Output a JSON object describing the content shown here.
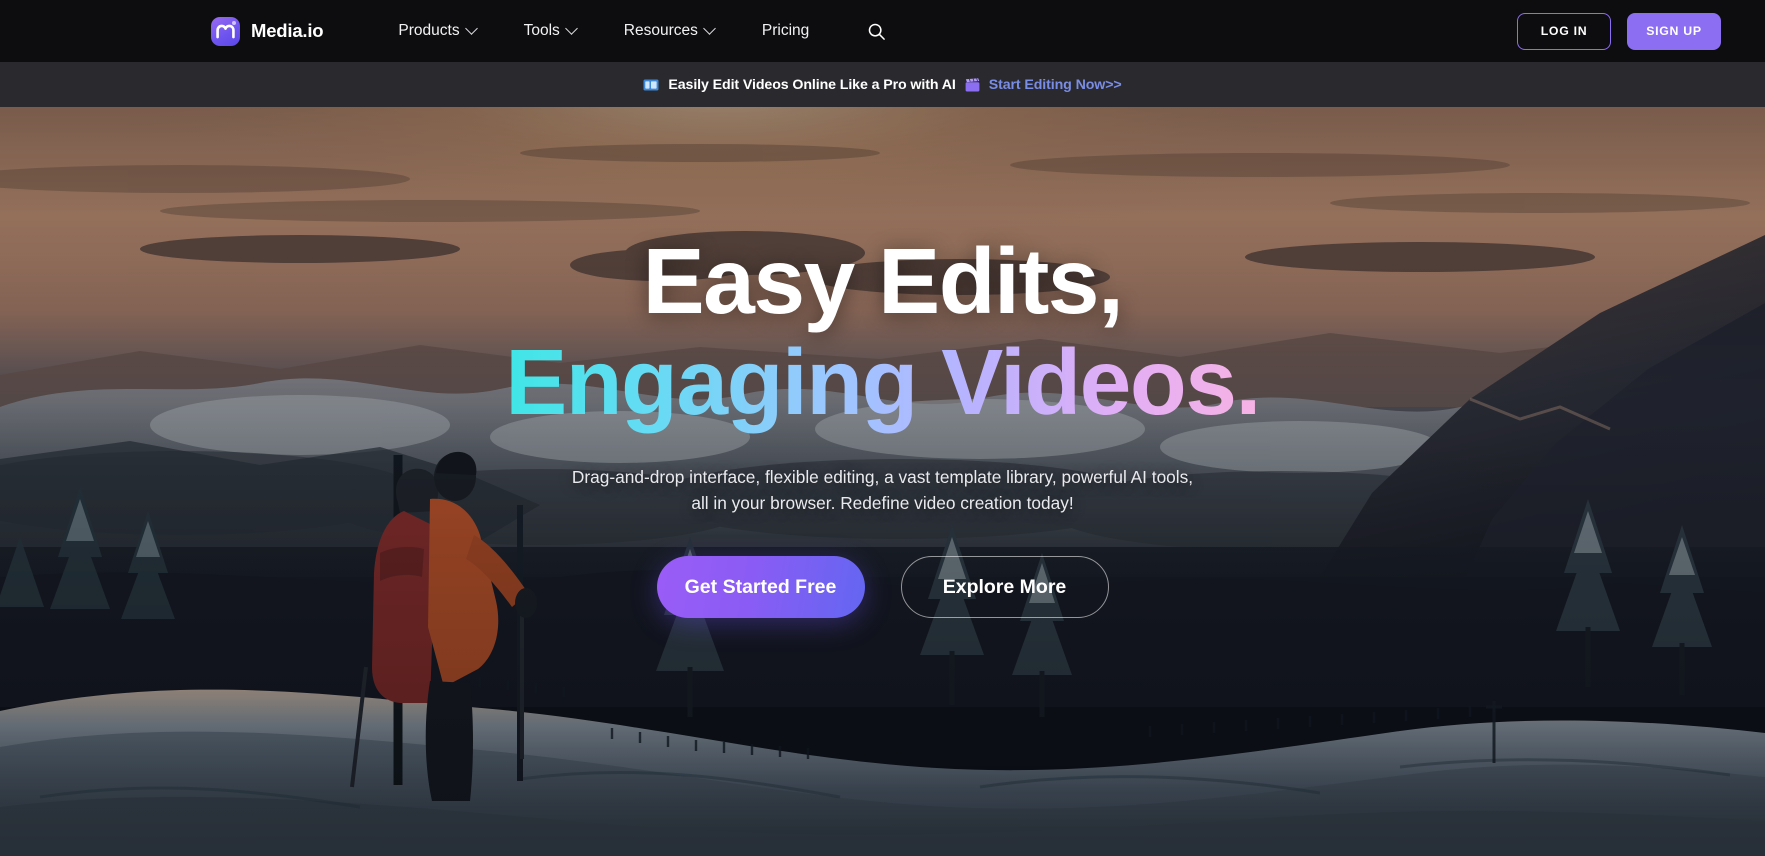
{
  "brand": {
    "name": "Media.io",
    "logo_icon": "media-io-logo-icon",
    "accent": "#8b6ef2"
  },
  "nav": {
    "items": [
      {
        "label": "Products",
        "has_dropdown": true,
        "icon": "chevron-down-icon"
      },
      {
        "label": "Tools",
        "has_dropdown": true,
        "icon": "chevron-down-icon"
      },
      {
        "label": "Resources",
        "has_dropdown": true,
        "icon": "chevron-down-icon"
      },
      {
        "label": "Pricing",
        "has_dropdown": false,
        "icon": ""
      }
    ],
    "search_icon": "search-icon",
    "login_label": "LOG IN",
    "signup_label": "SIGN UP"
  },
  "banner": {
    "lead_icon": "video-film-icon",
    "lead_icon_color": "#4a9de8",
    "text": "Easily Edit Videos Online Like a Pro with AI",
    "link_icon": "clapperboard-icon",
    "link_icon_color": "#8b6ef2",
    "link_label": "Start Editing Now>>",
    "link_color": "#7a8de6",
    "background": "#2a2a2e"
  },
  "hero": {
    "headline_line1": "Easy Edits,",
    "headline_line2": "Engaging Videos.",
    "headline_gradient_from": "#3fe6e6",
    "headline_gradient_to": "#f7b3e4",
    "subheadline": "Drag-and-drop interface, flexible editing, a vast template library, powerful AI tools, all in your browser. Redefine video creation today!",
    "primary_cta": "Get Started Free",
    "secondary_cta": "Explore More",
    "background_description": "snowy-mountain-sunset-hiker-photo"
  }
}
